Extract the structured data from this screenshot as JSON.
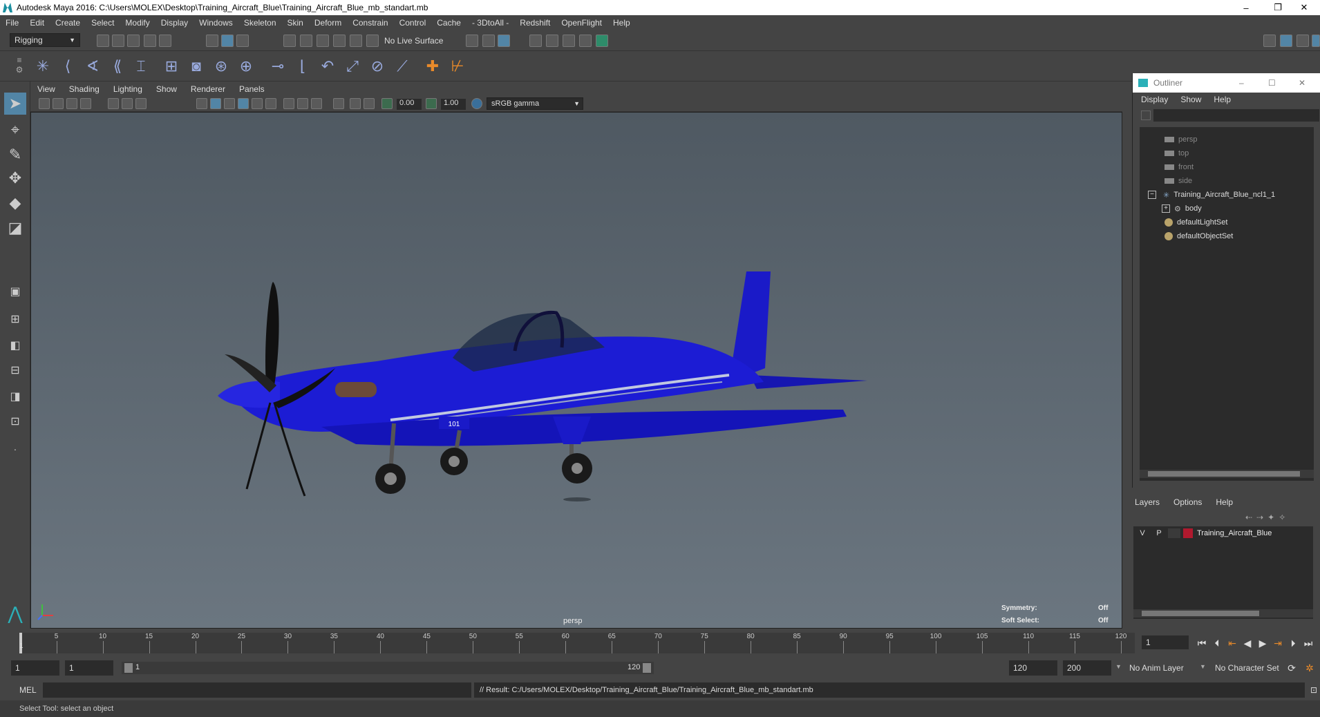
{
  "window": {
    "title": "Autodesk Maya 2016: C:\\Users\\MOLEX\\Desktop\\Training_Aircraft_Blue\\Training_Aircraft_Blue_mb_standart.mb",
    "minimize": "–",
    "restore": "❐",
    "close": "✕"
  },
  "menubar": [
    "File",
    "Edit",
    "Create",
    "Select",
    "Modify",
    "Display",
    "Windows",
    "Skeleton",
    "Skin",
    "Deform",
    "Constrain",
    "Control",
    "Cache",
    "- 3DtoAll -",
    "Redshift",
    "OpenFlight",
    "Help"
  ],
  "statusline": {
    "menuset": "Rigging",
    "live_surface": "No Live Surface"
  },
  "viewport": {
    "menus": [
      "View",
      "Shading",
      "Lighting",
      "Show",
      "Renderer",
      "Panels"
    ],
    "near": "0.00",
    "far": "1.00",
    "colorspace": "sRGB gamma",
    "camera_label": "persp",
    "symmetry_label": "Symmetry:",
    "symmetry_value": "Off",
    "soft_select_label": "Soft Select:",
    "soft_select_value": "Off",
    "aircraft_number": "101"
  },
  "outliner": {
    "title": "Outliner",
    "menus": [
      "Display",
      "Show",
      "Help"
    ],
    "items": [
      {
        "label": "persp",
        "icon": "camera-icon",
        "dim": true,
        "indent": 0
      },
      {
        "label": "top",
        "icon": "camera-icon",
        "dim": true,
        "indent": 0
      },
      {
        "label": "front",
        "icon": "camera-icon",
        "dim": true,
        "indent": 0
      },
      {
        "label": "side",
        "icon": "camera-icon",
        "dim": true,
        "indent": 0
      },
      {
        "label": "Training_Aircraft_Blue_ncl1_1",
        "icon": "joint-icon",
        "dim": false,
        "indent": 0
      },
      {
        "label": "body",
        "icon": "mesh-icon",
        "dim": false,
        "indent": 1
      },
      {
        "label": "defaultLightSet",
        "icon": "set-icon",
        "dim": false,
        "indent": 0
      },
      {
        "label": "defaultObjectSet",
        "icon": "set-icon",
        "dim": false,
        "indent": 0
      }
    ]
  },
  "layers": {
    "menus": [
      "Layers",
      "Options",
      "Help"
    ],
    "layer": {
      "v": "V",
      "p": "P",
      "name": "Training_Aircraft_Blue",
      "color": "#b0192e"
    }
  },
  "timeline": {
    "ticks": [
      "5",
      "10",
      "15",
      "20",
      "25",
      "30",
      "35",
      "40",
      "45",
      "50",
      "55",
      "60",
      "65",
      "70",
      "75",
      "80",
      "85",
      "90",
      "95",
      "100",
      "105",
      "110",
      "115",
      "120"
    ],
    "start_label": "1",
    "current_frame": "1"
  },
  "rangebar": {
    "start": "1",
    "playback_start": "1",
    "slider_start": "1",
    "slider_end": "120",
    "playback_end": "120",
    "end": "200",
    "anim_layer": "No Anim Layer",
    "character_set": "No Character Set"
  },
  "cmdline": {
    "lang": "MEL",
    "result": "// Result: C:/Users/MOLEX/Desktop/Training_Aircraft_Blue/Training_Aircraft_Blue_mb_standart.mb"
  },
  "helpline": "Select Tool: select an object"
}
